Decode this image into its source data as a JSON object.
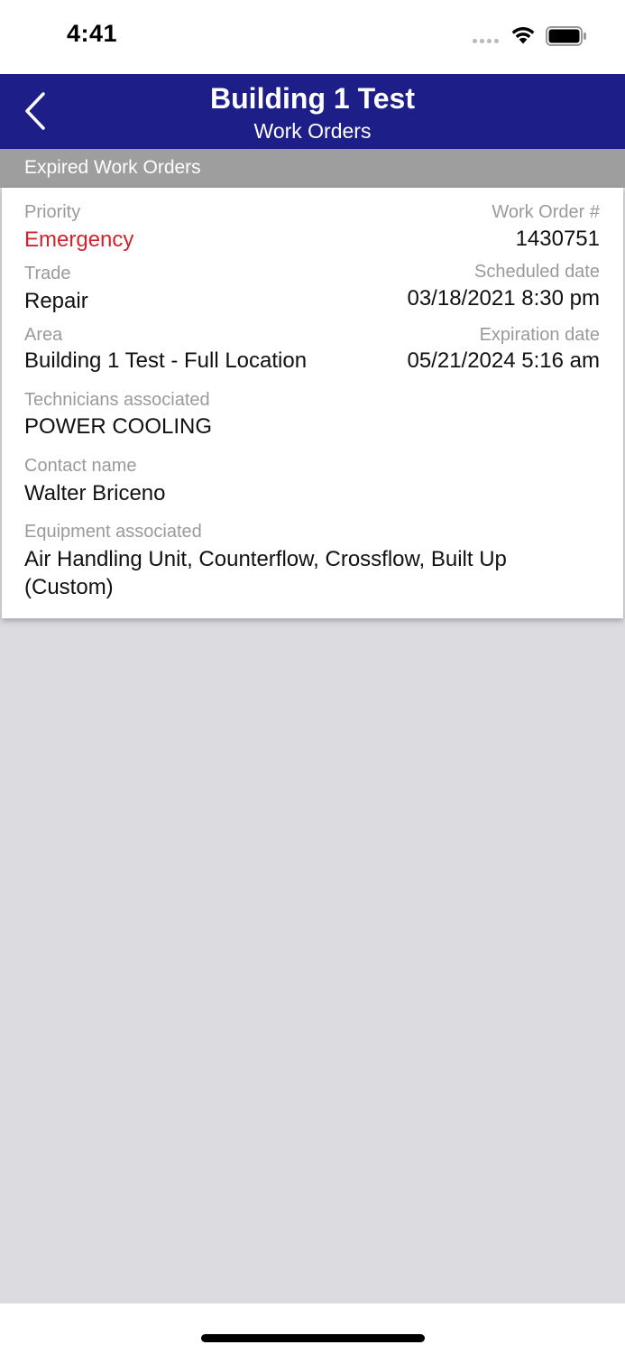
{
  "status_bar": {
    "time": "4:41"
  },
  "nav": {
    "title": "Building 1 Test",
    "subtitle": "Work Orders"
  },
  "section": {
    "label": "Expired Work Orders"
  },
  "work_order": {
    "priority_label": "Priority",
    "priority_value": "Emergency",
    "number_label": "Work Order #",
    "number_value": "1430751",
    "trade_label": "Trade",
    "trade_value": "Repair",
    "scheduled_label": "Scheduled date",
    "scheduled_value": "03/18/2021 8:30 pm",
    "area_label": "Area",
    "area_value": "Building 1 Test - Full Location",
    "expiration_label": "Expiration date",
    "expiration_value": "05/21/2024 5:16 am",
    "technicians_label": "Technicians associated",
    "technicians_value": "POWER COOLING",
    "contact_label": "Contact name",
    "contact_value": "Walter Briceno",
    "equipment_label": "Equipment associated",
    "equipment_value": "Air Handling Unit, Counterflow, Crossflow, Built Up (Custom)"
  },
  "colors": {
    "nav_background": "#1e1e88",
    "section_header": "#9e9e9e",
    "priority_emergency": "#d3222a",
    "content_background": "#dcdbe0"
  },
  "icons": {
    "back": "chevron-left-icon",
    "wifi": "wifi-icon",
    "battery": "battery-icon",
    "signal": "signal-dots-icon"
  }
}
